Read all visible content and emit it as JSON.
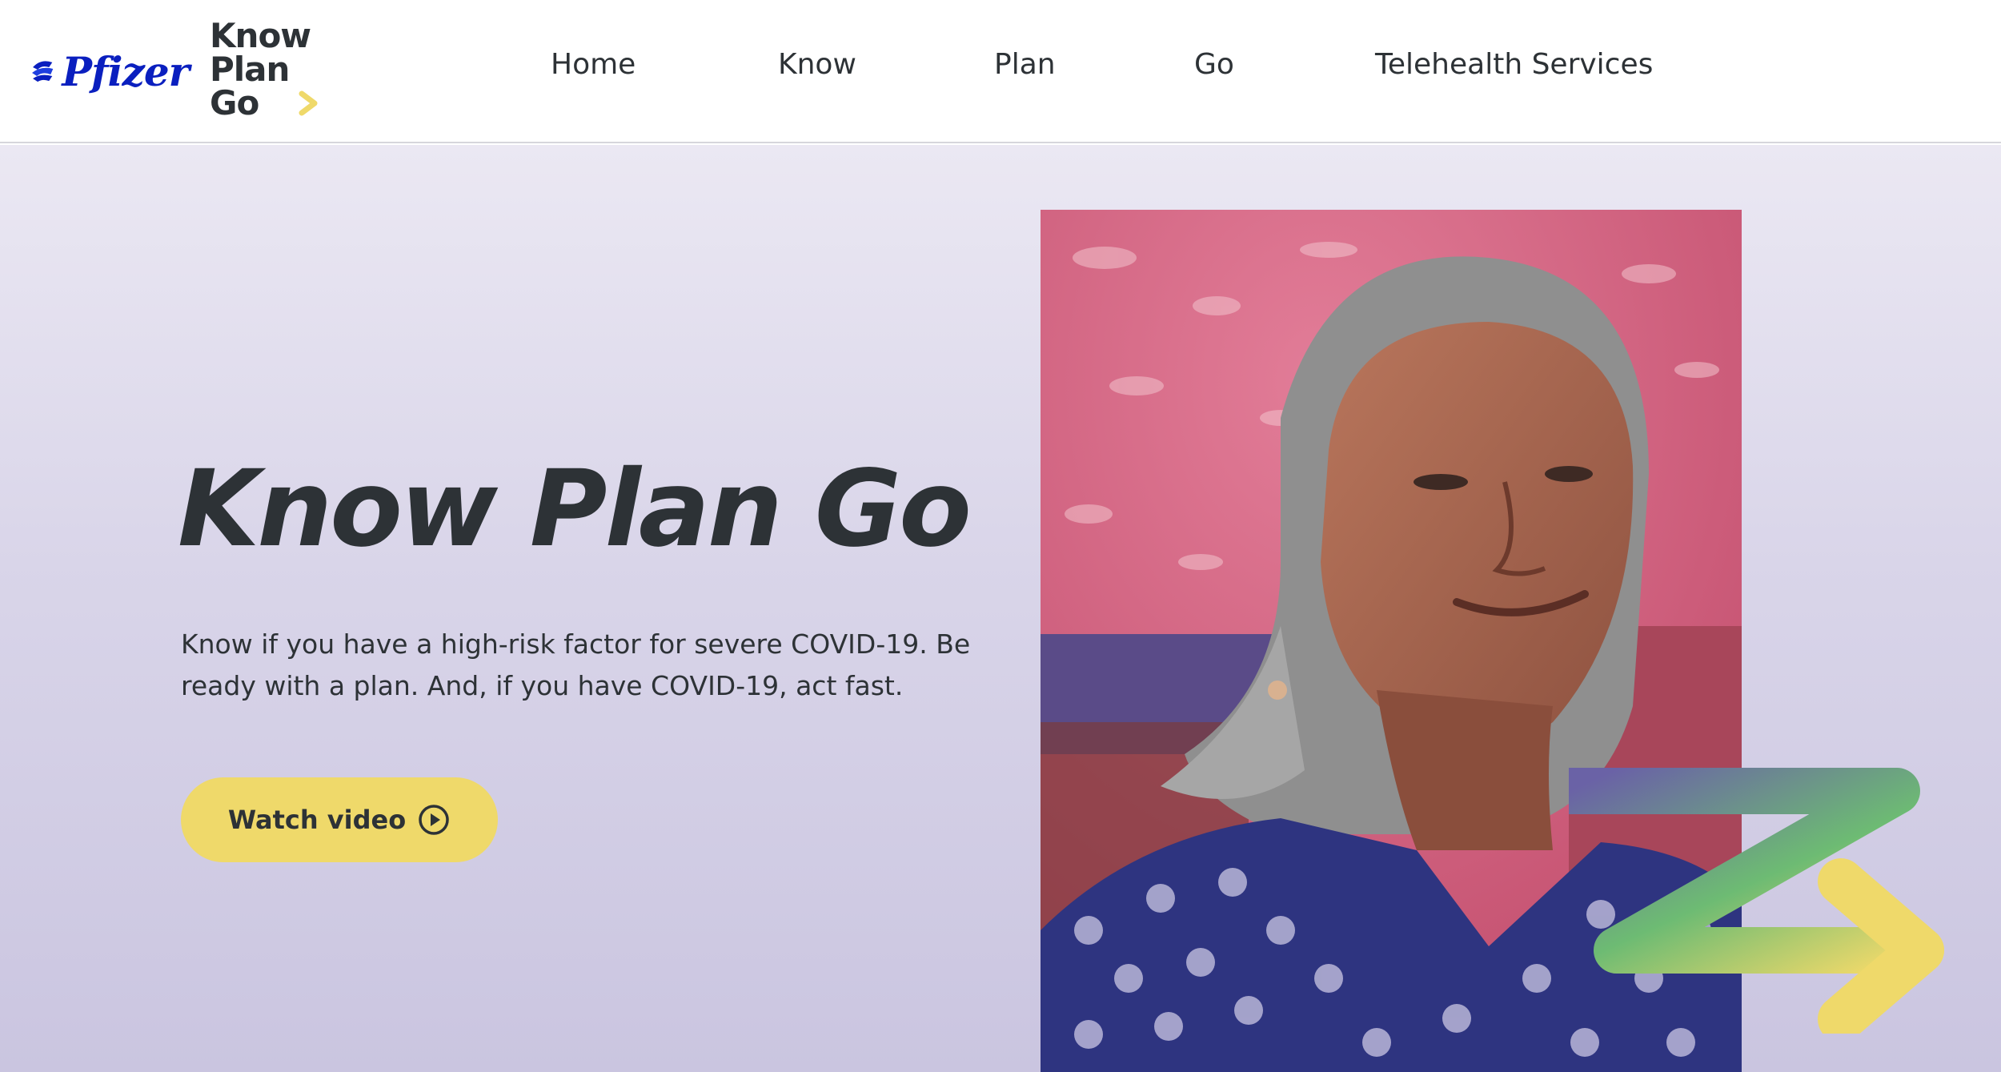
{
  "header": {
    "brand": {
      "pfizer_word": "Pfizer",
      "icon": "pfizer-logo-icon"
    },
    "kpg_logo": {
      "line1": "Know",
      "line2": "Plan",
      "line3": "Go",
      "icon": "arrow-right-icon"
    },
    "nav": [
      {
        "label": "Home"
      },
      {
        "label": "Know"
      },
      {
        "label": "Plan"
      },
      {
        "label": "Go"
      },
      {
        "label": "Telehealth Services"
      }
    ]
  },
  "hero": {
    "title": "Know Plan Go",
    "description": "Know if you have a high-risk factor for severe COVID-19. Be ready with a plan. And, if you have COVID-19, act fast.",
    "button": {
      "label": "Watch video",
      "icon": "play-circle-icon"
    },
    "image": {
      "subject": "woman-portrait"
    },
    "decoration": {
      "icon": "gradient-arrow-icon"
    }
  },
  "colors": {
    "accent_yellow": "#efd96a",
    "text_dark": "#2d3236",
    "pfizer_blue": "#0a1fbf",
    "arrow_purple": "#6a62a6",
    "arrow_green": "#6dbb73",
    "hero_bg_top": "#ebe8f3",
    "hero_bg_bottom": "#cac5e0"
  }
}
